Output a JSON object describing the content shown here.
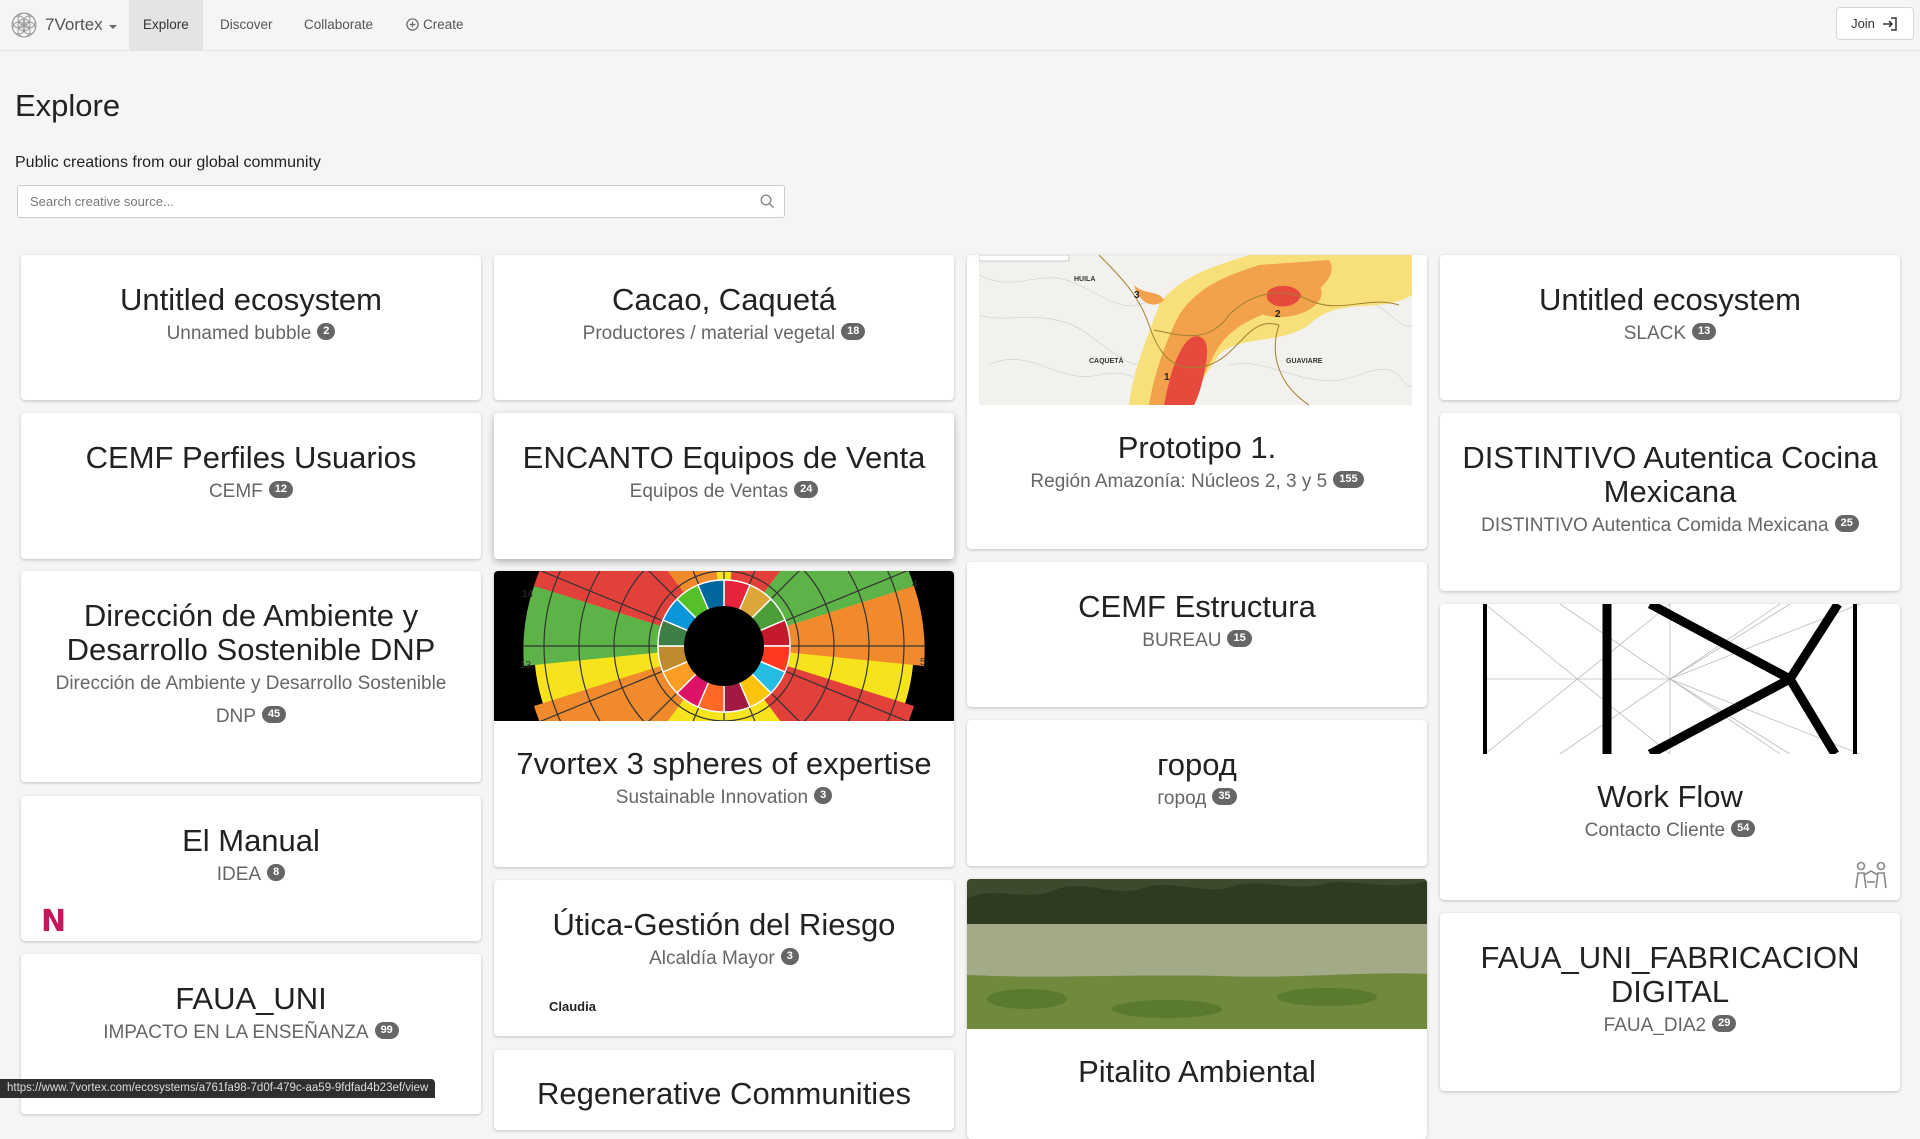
{
  "nav": {
    "brand": "7Vortex",
    "items": [
      "Explore",
      "Discover",
      "Collaborate",
      "Create"
    ],
    "join": "Join"
  },
  "page": {
    "title": "Explore",
    "subtitle": "Public creations from our global community",
    "search_placeholder": "Search creative source..."
  },
  "cards": [
    {
      "title": "Untitled ecosystem",
      "subtitle": "Unnamed bubble",
      "count": "2"
    },
    {
      "title": "CEMF Perfiles Usuarios",
      "subtitle": "CEMF",
      "count": "12"
    },
    {
      "title": "Dirección de Ambiente y Desarrollo Sostenible DNP",
      "subtitle": "Dirección de Ambiente y Desarrollo Sostenible DNP",
      "count": "45"
    },
    {
      "title": "El Manual",
      "subtitle": "IDEA",
      "count": "8",
      "logo": "N"
    },
    {
      "title": "FAUA_UNI",
      "subtitle": "IMPACTO EN LA ENSEÑANZA",
      "count": "99"
    },
    {
      "title": "Cacao, Caquetá",
      "subtitle": "Productores / material vegetal",
      "count": "18"
    },
    {
      "title": "ENCANTO Equipos de Venta",
      "subtitle": "Equipos de Ventas",
      "count": "24"
    },
    {
      "title": "7vortex 3 spheres of expertise",
      "subtitle": "Sustainable Innovation",
      "count": "3"
    },
    {
      "title": "Útica-Gestión del Riesgo",
      "subtitle": "Alcaldía Mayor",
      "count": "3",
      "author": "Claudia"
    },
    {
      "title": "Regenerative Communities"
    },
    {
      "title": "Prototipo 1.",
      "subtitle": "Región Amazonía: Núcleos 2, 3 y 5",
      "count": "155",
      "map_labels": [
        "HUILA",
        "CAQUETÁ",
        "GUAVIARE",
        "1",
        "2",
        "3"
      ]
    },
    {
      "title": "CEMF Estructura",
      "subtitle": "BUREAU",
      "count": "15"
    },
    {
      "title": "город",
      "subtitle": "город",
      "count": "35"
    },
    {
      "title": "Pitalito Ambiental"
    },
    {
      "title": "Untitled ecosystem",
      "subtitle": "SLACK",
      "count": "13"
    },
    {
      "title": "DISTINTIVO Autentica Cocina Mexicana",
      "subtitle": "DISTINTIVO Autentica Comida Mexicana",
      "count": "25"
    },
    {
      "title": "Work Flow",
      "subtitle": "Contacto Cliente",
      "count": "54"
    },
    {
      "title": "FAUA_UNI_FABRICACION DIGITAL",
      "subtitle": "FAUA_DIA2",
      "count": "29"
    }
  ],
  "sdg_numbers": [
    "14",
    "13",
    "4",
    "5"
  ],
  "status_url": "https://www.7vortex.com/ecosystems/a761fa98-7d0f-479c-aa59-9fdfad4b23ef/view",
  "colors": {
    "accent": "#c2185b",
    "badge": "#666666"
  }
}
